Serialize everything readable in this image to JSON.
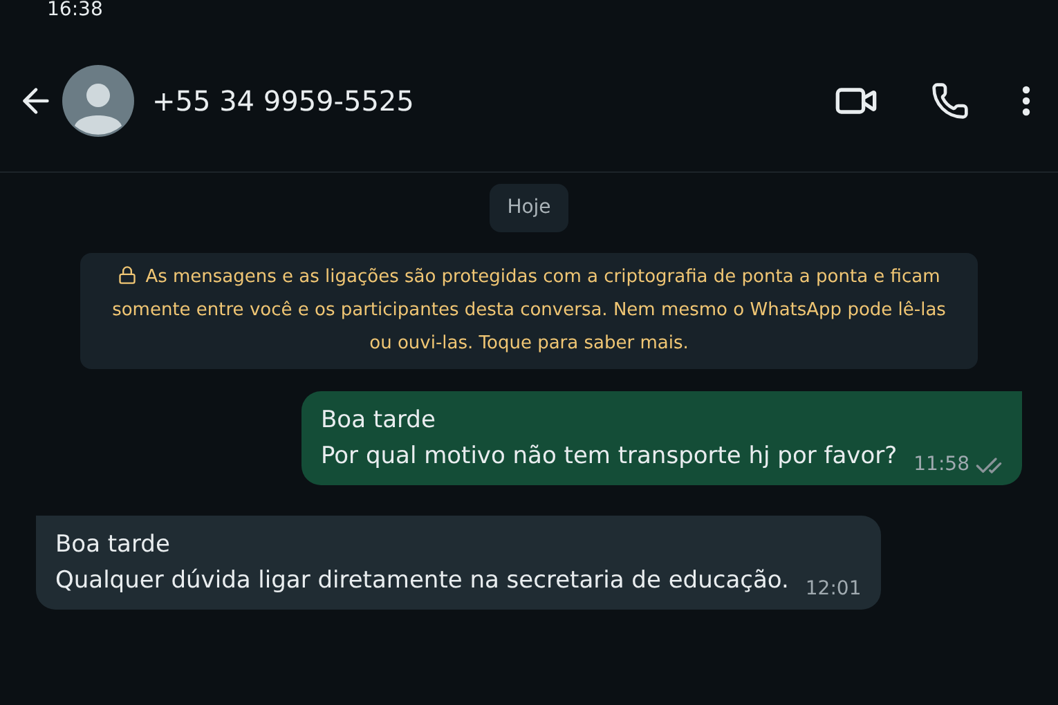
{
  "status_bar": {
    "time": "16:38"
  },
  "header": {
    "contact": "+55 34 9959-5525"
  },
  "date_chip": "Hoje",
  "encryption_notice": "As mensagens e as ligações são protegidas com a criptografia de ponta a ponta e ficam somente entre você e os participantes desta conversa. Nem mesmo o WhatsApp pode lê-las ou ouvi-las. Toque para saber mais.",
  "messages": [
    {
      "kind": "outgoing",
      "lines": [
        "Boa tarde",
        "Por qual motivo não tem transporte hj por favor?"
      ],
      "time": "11:58",
      "read": false
    },
    {
      "kind": "incoming",
      "lines": [
        "Boa tarde",
        "Qualquer dúvida ligar diretamente na secretaria de educação."
      ],
      "time": "12:01"
    }
  ]
}
